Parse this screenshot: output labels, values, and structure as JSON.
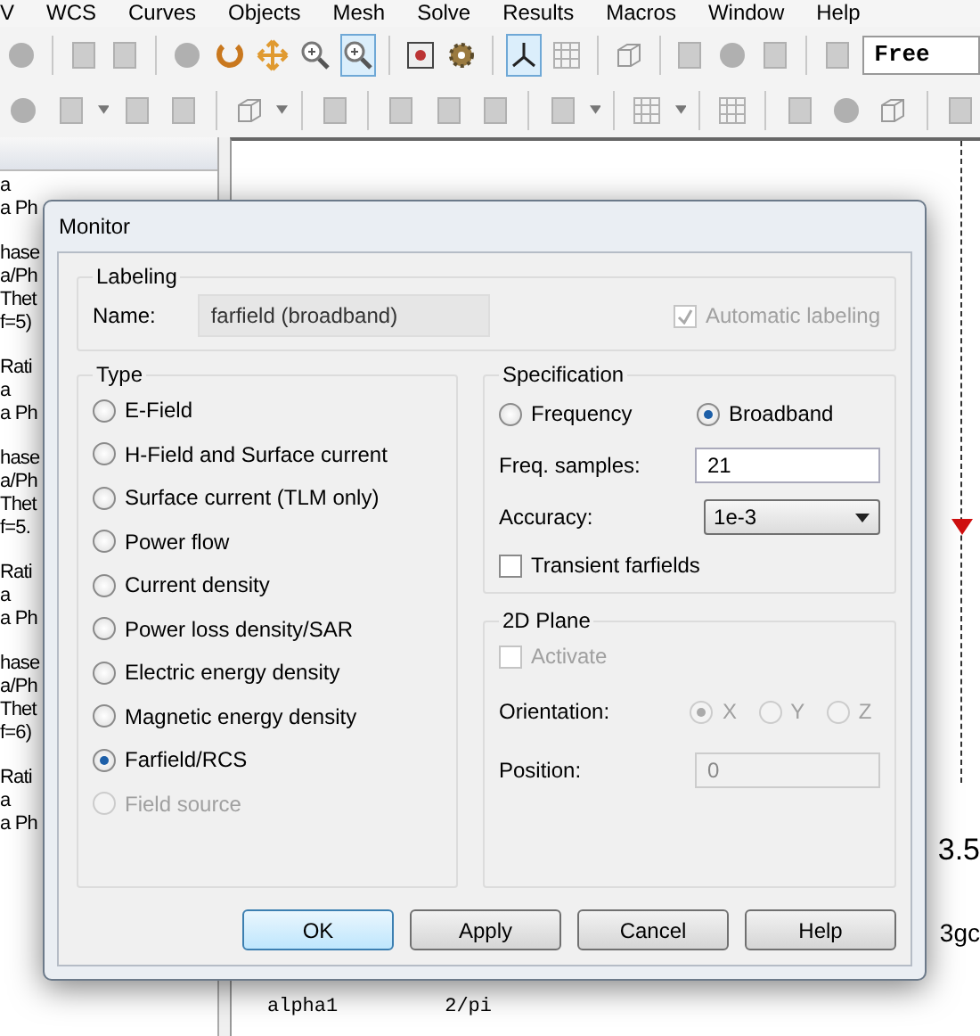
{
  "menu": [
    "V",
    "WCS",
    "Curves",
    "Objects",
    "Mesh",
    "Solve",
    "Results",
    "Macros",
    "Window",
    "Help"
  ],
  "toolbars": [
    {
      "items": [
        {
          "kind": "sphere",
          "selected": false
        },
        {
          "kind": "sep"
        },
        {
          "kind": "sheet",
          "selected": false
        },
        {
          "kind": "sheet",
          "selected": false
        },
        {
          "kind": "sep"
        },
        {
          "kind": "sphere",
          "selected": false
        },
        {
          "kind": "rotate",
          "selected": false
        },
        {
          "kind": "move",
          "selected": false
        },
        {
          "kind": "zoom",
          "selected": false
        },
        {
          "kind": "zoom",
          "selected": true
        },
        {
          "kind": "sep"
        },
        {
          "kind": "fit",
          "selected": false
        },
        {
          "kind": "gear",
          "selected": false
        },
        {
          "kind": "sep"
        },
        {
          "kind": "axes",
          "selected": true
        },
        {
          "kind": "grid",
          "selected": false
        },
        {
          "kind": "sep"
        },
        {
          "kind": "cube",
          "selected": false
        },
        {
          "kind": "sep"
        },
        {
          "kind": "sheet",
          "selected": false
        },
        {
          "kind": "sphere",
          "selected": false
        },
        {
          "kind": "sheet",
          "selected": false
        },
        {
          "kind": "sep"
        },
        {
          "kind": "sheet",
          "selected": false
        }
      ],
      "combo": "Free"
    },
    {
      "items": [
        {
          "kind": "sphere",
          "selected": false
        },
        {
          "kind": "sheet",
          "selected": false
        },
        {
          "kind": "caret"
        },
        {
          "kind": "sheet",
          "selected": false
        },
        {
          "kind": "sheet",
          "selected": false
        },
        {
          "kind": "sep"
        },
        {
          "kind": "cube",
          "selected": false
        },
        {
          "kind": "caret"
        },
        {
          "kind": "sep"
        },
        {
          "kind": "sheet",
          "selected": false
        },
        {
          "kind": "sep"
        },
        {
          "kind": "sheet",
          "selected": false
        },
        {
          "kind": "sheet",
          "selected": false
        },
        {
          "kind": "sheet",
          "selected": false
        },
        {
          "kind": "sep"
        },
        {
          "kind": "sheet",
          "selected": false
        },
        {
          "kind": "caret"
        },
        {
          "kind": "sep"
        },
        {
          "kind": "grid",
          "selected": false
        },
        {
          "kind": "caret"
        },
        {
          "kind": "sep"
        },
        {
          "kind": "grid",
          "selected": false
        },
        {
          "kind": "sep"
        },
        {
          "kind": "sheet",
          "selected": false
        },
        {
          "kind": "sphere",
          "selected": false
        },
        {
          "kind": "cube",
          "selected": false
        },
        {
          "kind": "sep"
        },
        {
          "kind": "sheet",
          "selected": false
        }
      ]
    }
  ],
  "side_panel": {
    "groups": [
      [
        "a",
        "a Ph"
      ],
      [
        "hase",
        "a/Ph",
        "Thet",
        "f=5)"
      ],
      [
        "Rati",
        "a",
        "a Ph"
      ],
      [
        "hase",
        "a/Ph",
        "Thet",
        "f=5."
      ],
      [
        "Rati",
        "a",
        "a Ph"
      ],
      [
        "hase",
        "a/Ph",
        "Thet",
        "f=6)"
      ],
      [
        "Rati",
        "a",
        "a Ph"
      ]
    ]
  },
  "plot": {
    "tick_label": "3.5",
    "legend": "3gc"
  },
  "table": {
    "cells": [
      "alpha1",
      "2/pi"
    ]
  },
  "dialog": {
    "title": "Monitor",
    "labeling": {
      "title": "Labeling",
      "name_label": "Name:",
      "name_value": "farfield (broadband)",
      "auto": {
        "label": "Automatic labeling",
        "checked": true,
        "disabled": true
      }
    },
    "type": {
      "title": "Type",
      "options": [
        {
          "label": "E-Field",
          "selected": false,
          "disabled": false
        },
        {
          "label": "H-Field and Surface current",
          "selected": false,
          "disabled": false
        },
        {
          "label": "Surface current (TLM only)",
          "selected": false,
          "disabled": false
        },
        {
          "label": "Power flow",
          "selected": false,
          "disabled": false
        },
        {
          "label": "Current density",
          "selected": false,
          "disabled": false
        },
        {
          "label": "Power loss density/SAR",
          "selected": false,
          "disabled": false
        },
        {
          "label": "Electric energy density",
          "selected": false,
          "disabled": false
        },
        {
          "label": "Magnetic energy density",
          "selected": false,
          "disabled": false
        },
        {
          "label": "Farfield/RCS",
          "selected": true,
          "disabled": false
        },
        {
          "label": "Field source",
          "selected": false,
          "disabled": true
        }
      ]
    },
    "specification": {
      "title": "Specification",
      "modes": [
        {
          "label": "Frequency",
          "selected": false
        },
        {
          "label": "Broadband",
          "selected": true
        }
      ],
      "samples_label": "Freq. samples:",
      "samples_value": "21",
      "accuracy_label": "Accuracy:",
      "accuracy_value": "1e-3",
      "transient": {
        "label": "Transient farfields",
        "checked": false,
        "disabled": false
      }
    },
    "plane": {
      "title": "2D Plane",
      "activate": {
        "label": "Activate",
        "checked": false,
        "disabled": true
      },
      "orientation_label": "Orientation:",
      "axes": [
        {
          "label": "X",
          "selected": true
        },
        {
          "label": "Y",
          "selected": false
        },
        {
          "label": "Z",
          "selected": false
        }
      ],
      "disabled": true,
      "position_label": "Position:",
      "position_value": "0"
    },
    "buttons": [
      {
        "label": "OK",
        "default": true
      },
      {
        "label": "Apply",
        "default": false
      },
      {
        "label": "Cancel",
        "default": false
      },
      {
        "label": "Help",
        "default": false
      }
    ]
  }
}
